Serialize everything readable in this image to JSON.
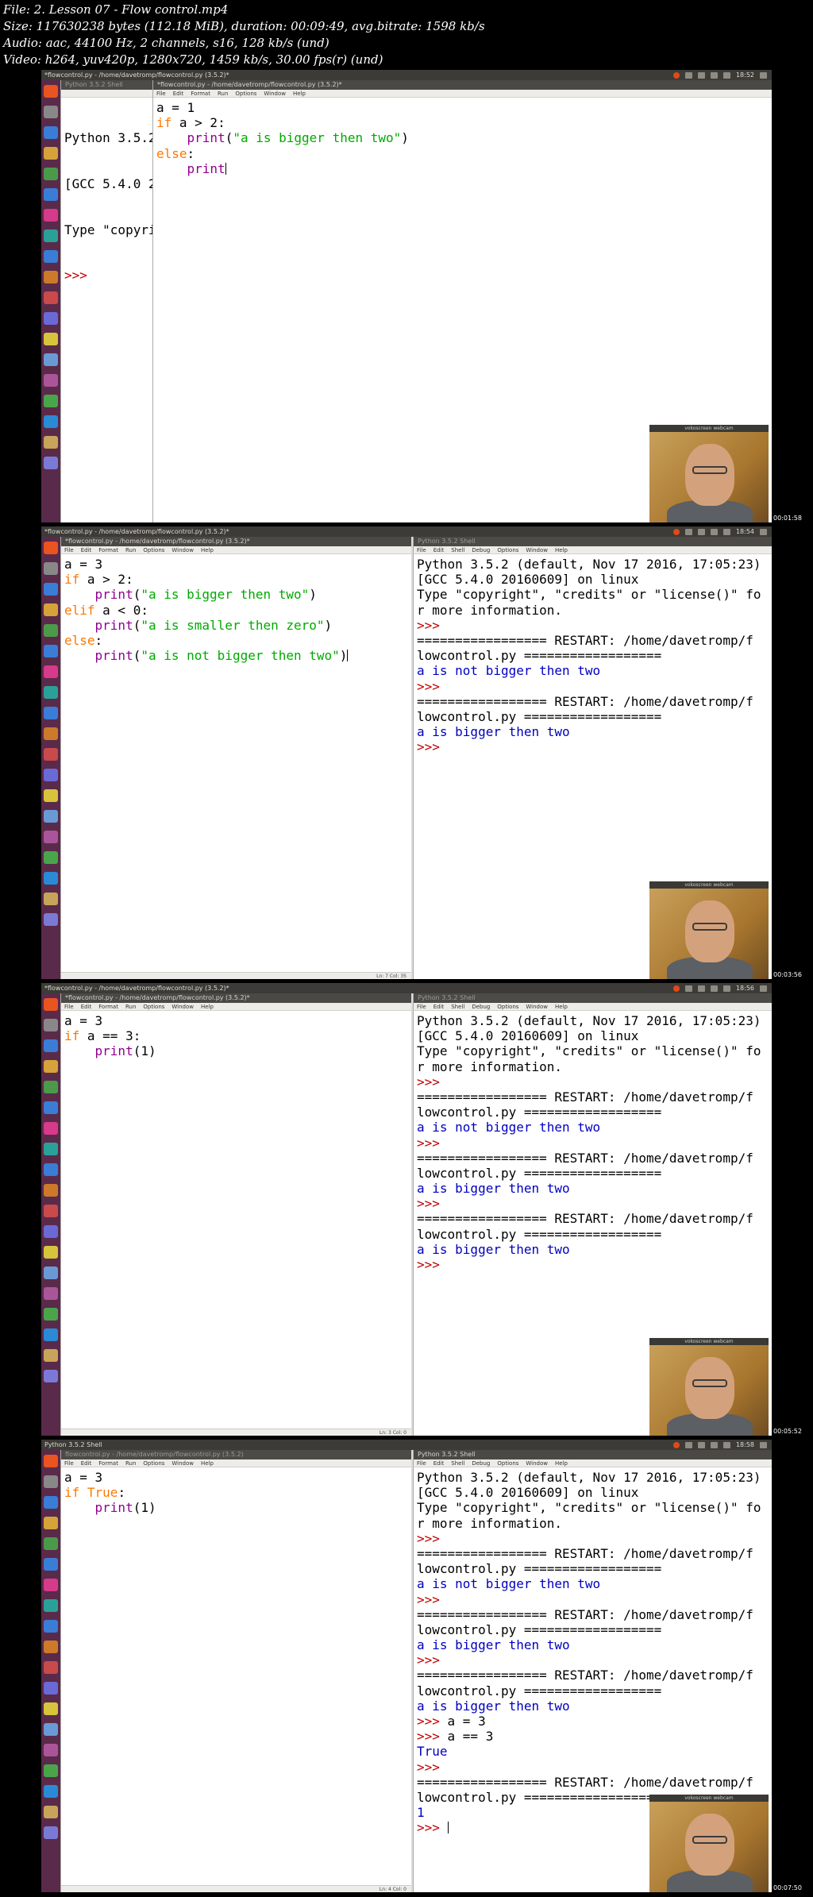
{
  "info": {
    "line1": "File: 2. Lesson 07 - Flow control.mp4",
    "line2": "Size: 117630238 bytes (112.18 MiB), duration: 00:09:49, avg.bitrate: 1598 kb/s",
    "line3": "Audio: aac, 44100 Hz, 2 channels, s16, 128 kb/s (und)",
    "line4": "Video: h264, yuv420p, 1280x720, 1459 kb/s, 30.00 fps(r) (und)"
  },
  "menus": {
    "editor": [
      "File",
      "Edit",
      "Format",
      "Run",
      "Options",
      "Window",
      "Help"
    ],
    "shell": [
      "File",
      "Edit",
      "Shell",
      "Debug",
      "Options",
      "Window",
      "Help"
    ]
  },
  "webcam_title": "vokoscreen webcam",
  "frames": [
    {
      "timestamp": "00:01:58",
      "topbar_title": "*flowcontrol.py - /home/davetromp/flowcontrol.py (3.5.2)*",
      "clock": "18:52",
      "back_title": "Python 3.5.2 Shell",
      "editor_title": "*flowcontrol.py - /home/davetromp/flowcontrol.py (3.5.2)*",
      "back_lines": [
        "Python 3.5.2",
        "[GCC 5.4.0 2",
        "Type \"copyri",
        ">>>"
      ],
      "code": [
        [
          [
            "plain",
            "a = 1"
          ]
        ],
        [
          [
            "kw",
            "if"
          ],
          [
            "plain",
            " a > 2:"
          ]
        ],
        [
          [
            "plain",
            "    "
          ],
          [
            "builtin",
            "print"
          ],
          [
            "plain",
            "("
          ],
          [
            "str",
            "\"a is bigger then two\""
          ],
          [
            "plain",
            ")"
          ]
        ],
        [
          [
            "kw",
            "else"
          ],
          [
            "plain",
            ":"
          ]
        ],
        [
          [
            "plain",
            "    "
          ],
          [
            "builtin",
            "print"
          ]
        ]
      ]
    },
    {
      "timestamp": "00:03:56",
      "topbar_title": "*flowcontrol.py - /home/davetromp/flowcontrol.py (3.5.2)*",
      "clock": "18:54",
      "editor_title": "*flowcontrol.py - /home/davetromp/flowcontrol.py (3.5.2)*",
      "shell_title": "Python 3.5.2 Shell",
      "status": "Ln: 7  Col: 35",
      "code": [
        [
          [
            "plain",
            "a = 3"
          ]
        ],
        [
          [
            "kw",
            "if"
          ],
          [
            "plain",
            " a > 2:"
          ]
        ],
        [
          [
            "plain",
            "    "
          ],
          [
            "builtin",
            "print"
          ],
          [
            "plain",
            "("
          ],
          [
            "str",
            "\"a is bigger then two\""
          ],
          [
            "plain",
            ")"
          ]
        ],
        [
          [
            "kw",
            "elif"
          ],
          [
            "plain",
            " a < 0:"
          ]
        ],
        [
          [
            "plain",
            "    "
          ],
          [
            "builtin",
            "print"
          ],
          [
            "plain",
            "("
          ],
          [
            "str",
            "\"a is smaller then zero\""
          ],
          [
            "plain",
            ")"
          ]
        ],
        [
          [
            "kw",
            "else"
          ],
          [
            "plain",
            ":"
          ]
        ],
        [
          [
            "plain",
            "    "
          ],
          [
            "builtin",
            "print"
          ],
          [
            "plain",
            "("
          ],
          [
            "str",
            "\"a is not bigger then two\""
          ],
          [
            "plain",
            ")"
          ]
        ]
      ],
      "shell": [
        [
          [
            "plain",
            "Python 3.5.2 (default, Nov 17 2016, 17:05:23)"
          ]
        ],
        [
          [
            "plain",
            "[GCC 5.4.0 20160609] on linux"
          ]
        ],
        [
          [
            "plain",
            "Type \"copyright\", \"credits\" or \"license()\" fo"
          ]
        ],
        [
          [
            "plain",
            "r more information."
          ]
        ],
        [
          [
            "prompt",
            ">>> "
          ]
        ],
        [
          [
            "plain",
            "================= RESTART: /home/davetromp/f"
          ]
        ],
        [
          [
            "plain",
            "lowcontrol.py =================="
          ]
        ],
        [
          [
            "out",
            "a is not bigger then two"
          ]
        ],
        [
          [
            "prompt",
            ">>> "
          ]
        ],
        [
          [
            "plain",
            "================= RESTART: /home/davetromp/f"
          ]
        ],
        [
          [
            "plain",
            "lowcontrol.py =================="
          ]
        ],
        [
          [
            "out",
            "a is bigger then two"
          ]
        ],
        [
          [
            "prompt",
            ">>> "
          ]
        ]
      ]
    },
    {
      "timestamp": "00:05:52",
      "topbar_title": "*flowcontrol.py - /home/davetromp/flowcontrol.py (3.5.2)*",
      "clock": "18:56",
      "editor_title": "*flowcontrol.py - /home/davetromp/flowcontrol.py (3.5.2)*",
      "shell_title": "Python 3.5.2 Shell",
      "status": "Ln: 3  Col: 0",
      "code": [
        [
          [
            "plain",
            "a = 3"
          ]
        ],
        [
          [
            "kw",
            "if"
          ],
          [
            "plain",
            " a == 3:"
          ]
        ],
        [
          [
            "plain",
            "    "
          ],
          [
            "builtin",
            "print"
          ],
          [
            "plain",
            "(1)"
          ]
        ]
      ],
      "shell": [
        [
          [
            "plain",
            "Python 3.5.2 (default, Nov 17 2016, 17:05:23)"
          ]
        ],
        [
          [
            "plain",
            "[GCC 5.4.0 20160609] on linux"
          ]
        ],
        [
          [
            "plain",
            "Type \"copyright\", \"credits\" or \"license()\" fo"
          ]
        ],
        [
          [
            "plain",
            "r more information."
          ]
        ],
        [
          [
            "prompt",
            ">>> "
          ]
        ],
        [
          [
            "plain",
            "================= RESTART: /home/davetromp/f"
          ]
        ],
        [
          [
            "plain",
            "lowcontrol.py =================="
          ]
        ],
        [
          [
            "out",
            "a is not bigger then two"
          ]
        ],
        [
          [
            "prompt",
            ">>> "
          ]
        ],
        [
          [
            "plain",
            "================= RESTART: /home/davetromp/f"
          ]
        ],
        [
          [
            "plain",
            "lowcontrol.py =================="
          ]
        ],
        [
          [
            "out",
            "a is bigger then two"
          ]
        ],
        [
          [
            "prompt",
            ">>> "
          ]
        ],
        [
          [
            "plain",
            "================= RESTART: /home/davetromp/f"
          ]
        ],
        [
          [
            "plain",
            "lowcontrol.py =================="
          ]
        ],
        [
          [
            "out",
            "a is bigger then two"
          ]
        ],
        [
          [
            "prompt",
            ">>> "
          ]
        ]
      ]
    },
    {
      "timestamp": "00:07:50",
      "topbar_title": "Python 3.5.2 Shell",
      "clock": "18:58",
      "editor_title": "flowcontrol.py - /home/davetromp/flowcontrol.py (3.5.2)",
      "shell_title": "Python 3.5.2 Shell",
      "status": "Ln: 4  Col: 0",
      "code": [
        [
          [
            "plain",
            "a = 3"
          ]
        ],
        [
          [
            "kw",
            "if"
          ],
          [
            "plain",
            " "
          ],
          [
            "kw",
            "True"
          ],
          [
            "plain",
            ":"
          ]
        ],
        [
          [
            "plain",
            "    "
          ],
          [
            "builtin",
            "print"
          ],
          [
            "plain",
            "(1)"
          ]
        ]
      ],
      "shell": [
        [
          [
            "plain",
            "Python 3.5.2 (default, Nov 17 2016, 17:05:23)"
          ]
        ],
        [
          [
            "plain",
            "[GCC 5.4.0 20160609] on linux"
          ]
        ],
        [
          [
            "plain",
            "Type \"copyright\", \"credits\" or \"license()\" fo"
          ]
        ],
        [
          [
            "plain",
            "r more information."
          ]
        ],
        [
          [
            "prompt",
            ">>> "
          ]
        ],
        [
          [
            "plain",
            "================= RESTART: /home/davetromp/f"
          ]
        ],
        [
          [
            "plain",
            "lowcontrol.py =================="
          ]
        ],
        [
          [
            "out",
            "a is not bigger then two"
          ]
        ],
        [
          [
            "prompt",
            ">>> "
          ]
        ],
        [
          [
            "plain",
            "================= RESTART: /home/davetromp/f"
          ]
        ],
        [
          [
            "plain",
            "lowcontrol.py =================="
          ]
        ],
        [
          [
            "out",
            "a is bigger then two"
          ]
        ],
        [
          [
            "prompt",
            ">>> "
          ]
        ],
        [
          [
            "plain",
            "================= RESTART: /home/davetromp/f"
          ]
        ],
        [
          [
            "plain",
            "lowcontrol.py =================="
          ]
        ],
        [
          [
            "out",
            "a is bigger then two"
          ]
        ],
        [
          [
            "prompt",
            ">>> "
          ],
          [
            "plain",
            "a = 3"
          ]
        ],
        [
          [
            "prompt",
            ">>> "
          ],
          [
            "plain",
            "a == 3"
          ]
        ],
        [
          [
            "out",
            "True"
          ]
        ],
        [
          [
            "prompt",
            ">>> "
          ]
        ],
        [
          [
            "plain",
            "================= RESTART: /home/davetromp/f"
          ]
        ],
        [
          [
            "plain",
            "lowcontrol.py =================="
          ]
        ],
        [
          [
            "out",
            "1"
          ]
        ],
        [
          [
            "prompt",
            ">>> "
          ]
        ]
      ]
    }
  ]
}
